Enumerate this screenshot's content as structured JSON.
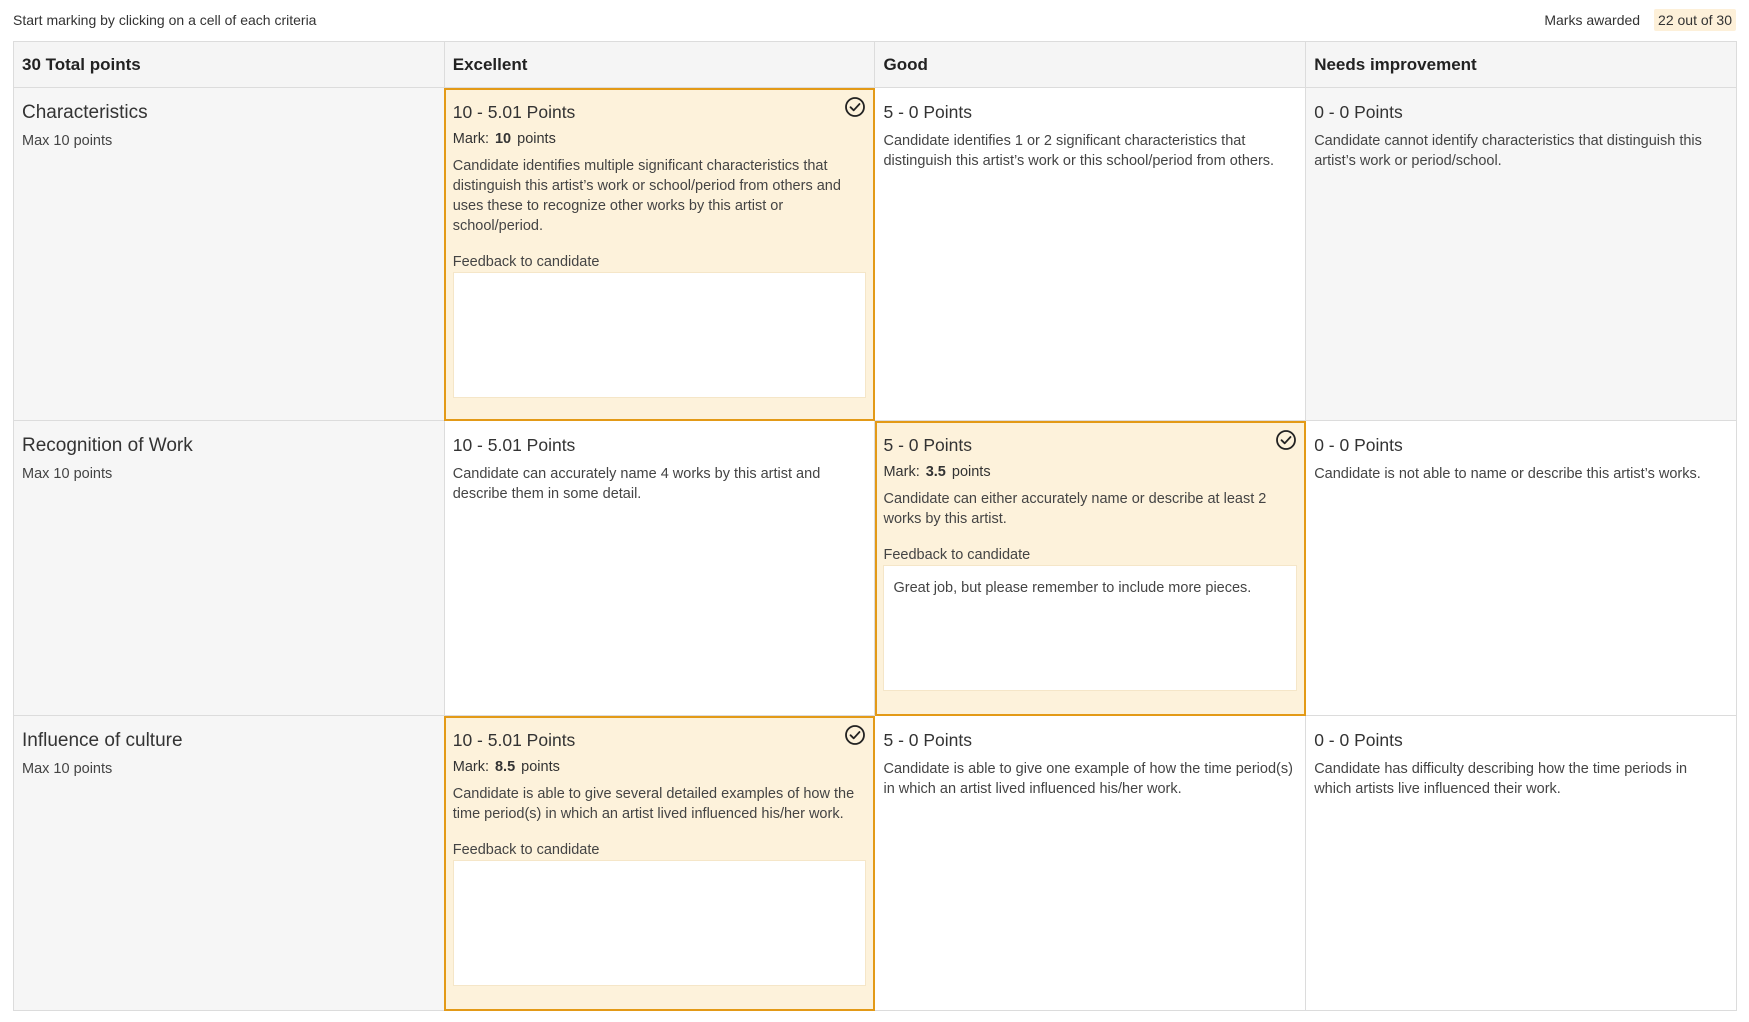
{
  "header": {
    "instruction": "Start marking by clicking on a cell of each criteria",
    "marks_label": "Marks awarded",
    "marks_value": "22 out of 30"
  },
  "columns": {
    "total": "30 Total points",
    "excellent": "Excellent",
    "good": "Good",
    "needs_improvement": "Needs improvement"
  },
  "rows": [
    {
      "title": "Characteristics",
      "max": "Max 10 points",
      "excellent": {
        "points": "10 - 5.01 Points",
        "mark_label": "Mark:",
        "mark_value": "10",
        "mark_unit": "points",
        "description": "Candidate identifies multiple significant characteristics that distinguish this artist’s work or school/period from others and uses these to recognize other works by this artist or school/period.",
        "feedback_label": "Feedback to candidate",
        "feedback_text": ""
      },
      "good": {
        "points": "5 - 0 Points",
        "description": "Candidate identifies 1 or 2 significant characteristics that distinguish this artist’s work or this school/period from others."
      },
      "needs_improvement": {
        "points": "0 - 0 Points",
        "description": "Candidate cannot identify characteristics that distinguish this artist’s work or period/school."
      }
    },
    {
      "title": "Recognition of Work",
      "max": "Max 10 points",
      "excellent": {
        "points": "10 - 5.01 Points",
        "description": "Candidate can accurately name 4 works by this artist and describe them in some detail."
      },
      "good": {
        "points": "5 - 0 Points",
        "mark_label": "Mark:",
        "mark_value": "3.5",
        "mark_unit": "points",
        "description": "Candidate can either accurately name or describe at least 2 works by this artist.",
        "feedback_label": "Feedback to candidate",
        "feedback_text": "Great job, but please remember to include more pieces."
      },
      "needs_improvement": {
        "points": "0 - 0 Points",
        "description": "Candidate is not able to name or describe this artist’s works."
      }
    },
    {
      "title": "Influence of culture",
      "max": "Max 10 points",
      "excellent": {
        "points": "10 - 5.01 Points",
        "mark_label": "Mark:",
        "mark_value": "8.5",
        "mark_unit": "points",
        "description": "Candidate is able to give several detailed examples of how the time period(s) in which an artist lived influenced his/her work.",
        "feedback_label": "Feedback to candidate",
        "feedback_text": ""
      },
      "good": {
        "points": "5 - 0 Points",
        "description": "Candidate is able to give one example of how the time period(s) in which an artist lived influenced his/her work."
      },
      "needs_improvement": {
        "points": "0 - 0 Points",
        "description": "Candidate has difficulty describing how the time periods in which artists live influenced their work."
      }
    }
  ],
  "colors": {
    "selected_border": "#e39a17",
    "selected_fill": "#fdf2db",
    "grid_border": "#dcdcdc"
  }
}
